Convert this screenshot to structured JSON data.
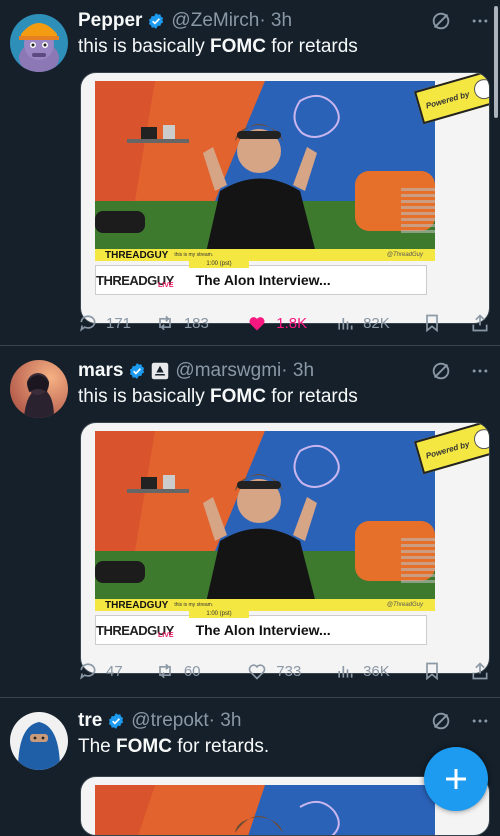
{
  "tweets": [
    {
      "name": "Pepper",
      "handle": "@ZeMirch",
      "time": "· 3h",
      "text_pre": "this is basically ",
      "text_bold": "FOMC",
      "text_post": " for retards",
      "media": {
        "brand": "THREADGUY",
        "live": "LIVE",
        "small_text": "this is my stream.",
        "signature": "@ThreadGuy",
        "time_strip": "1:00 (pst)",
        "title": "The Alon Interview...",
        "powered": "Powered by"
      },
      "replies": "171",
      "reposts": "183",
      "likes": "1.8K",
      "views": "82K",
      "liked": true
    },
    {
      "name": "mars",
      "handle": "@marswgmi",
      "time": "· 3h",
      "text_pre": "this is basically ",
      "text_bold": "FOMC",
      "text_post": " for retards",
      "media": {
        "brand": "THREADGUY",
        "live": "LIVE",
        "small_text": "this is my stream.",
        "signature": "@ThreadGuy",
        "time_strip": "1:00 (pst)",
        "title": "The Alon Interview...",
        "powered": "Powered by"
      },
      "replies": "47",
      "reposts": "60",
      "likes": "733",
      "views": "36K",
      "liked": false
    },
    {
      "name": "tre",
      "handle": "@trepokt",
      "time": "· 3h",
      "text_pre": "The ",
      "text_bold": "FOMC",
      "text_post": " for retards."
    }
  ],
  "colors": {
    "background": "#15202b",
    "divider": "#38444d",
    "muted_text": "#8b98a5",
    "verified": "#1d9bf0",
    "like": "#f91880"
  },
  "icons": {
    "reply": "reply-icon",
    "repost": "repost-icon",
    "like": "heart-icon",
    "views": "views-icon",
    "bookmark": "bookmark-icon",
    "share": "share-icon",
    "mute": "mute-icon",
    "more": "more-icon",
    "compose": "compose-icon"
  }
}
